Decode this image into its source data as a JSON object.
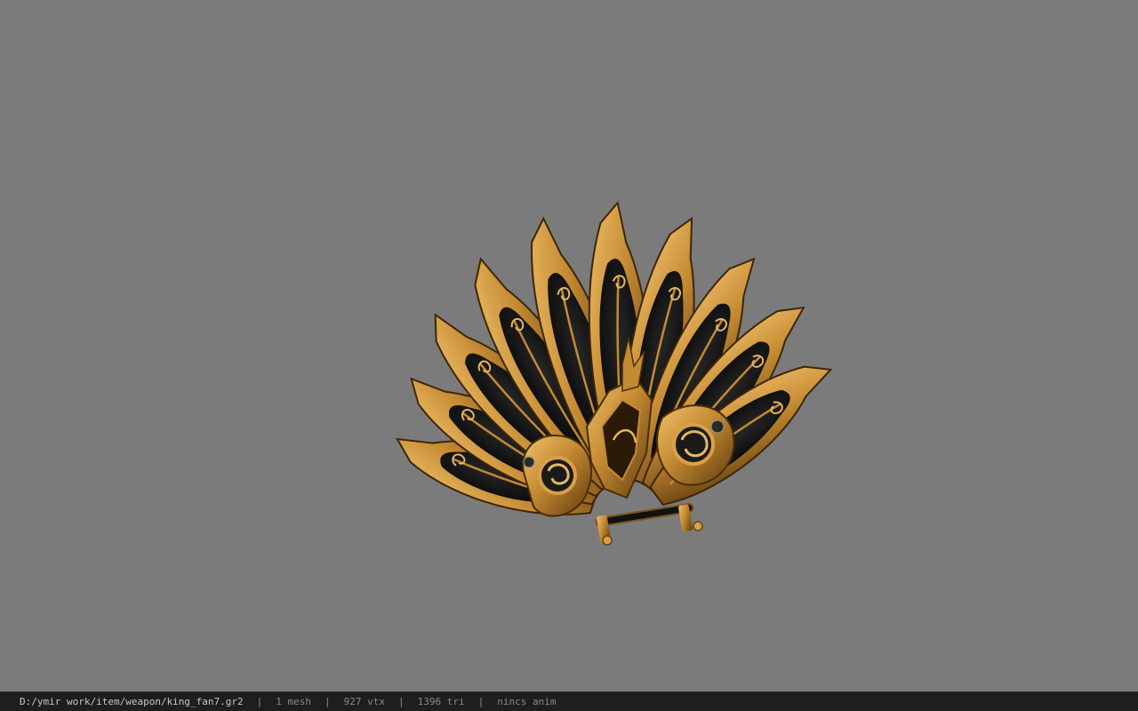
{
  "viewer": {
    "background_color": "#7b7b7b",
    "model": {
      "name": "king-fan-model",
      "colors": {
        "gold_light": "#e9b65f",
        "gold": "#c48a32",
        "gold_dark": "#6d4411",
        "panel_black": "#0d0d0d"
      }
    }
  },
  "statusbar": {
    "file_path": "D:/ymir work/item/weapon/king_fan7.gr2",
    "separator": "|",
    "mesh_count": "1 mesh",
    "vertex_count": "927 vtx",
    "triangle_count": "1396 tri",
    "animation": "nincs anim"
  }
}
